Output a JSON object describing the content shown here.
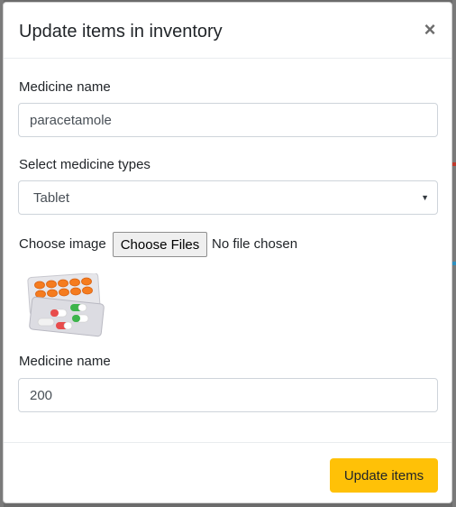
{
  "modal": {
    "title": "Update items in inventory",
    "close_label": "×"
  },
  "form": {
    "medicine_name_label": "Medicine name",
    "medicine_name_value": "paracetamole",
    "medicine_type_label": "Select medicine types",
    "medicine_type_selected": "Tablet",
    "image_label": "Choose image",
    "file_button_label": "Choose Files",
    "file_status": "No file chosen",
    "image_alt": "medicine blister packs",
    "quantity_label": "Medicine name",
    "quantity_value": "200"
  },
  "footer": {
    "submit_label": "Update items"
  },
  "colors": {
    "primary_action": "#ffc107",
    "overlay": "#6b6b6b"
  },
  "icons": {
    "close": "close-icon",
    "select_caret": "chevron-down-icon"
  }
}
